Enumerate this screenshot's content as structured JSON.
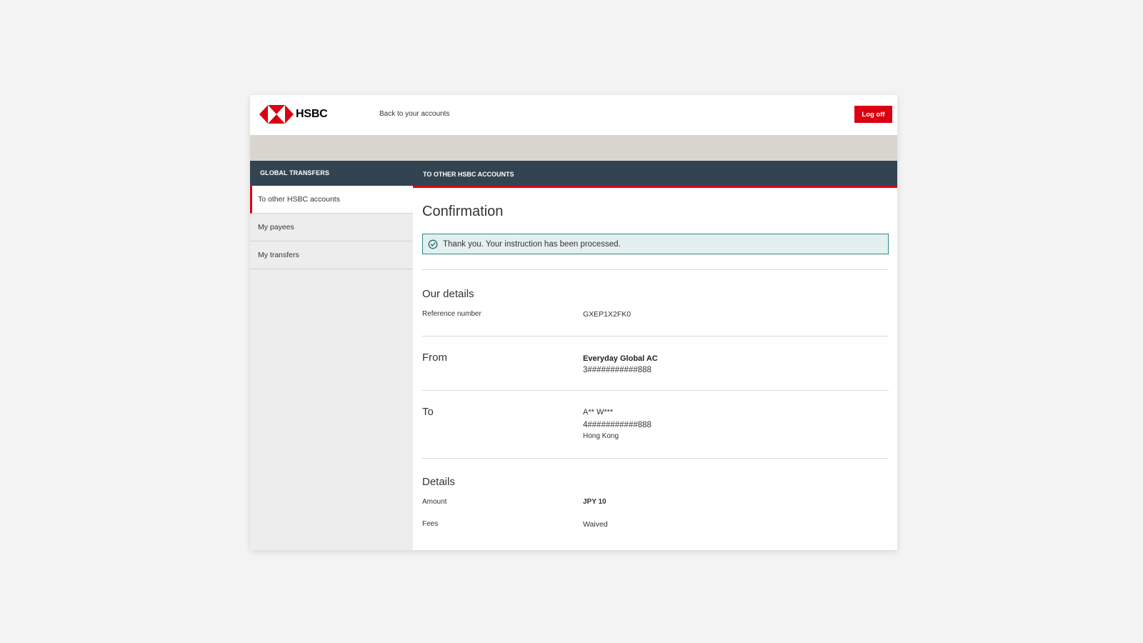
{
  "header": {
    "brand": "HSBC",
    "back_link": "Back to your accounts",
    "logoff_label": "Log off"
  },
  "sidebar": {
    "title": "GLOBAL TRANSFERS",
    "items": [
      {
        "label": "To other HSBC accounts",
        "active": true
      },
      {
        "label": "My payees",
        "active": false
      },
      {
        "label": "My transfers",
        "active": false
      }
    ]
  },
  "main": {
    "section_header": "TO OTHER HSBC ACCOUNTS",
    "page_title": "Confirmation",
    "alert_text": "Thank you. Your instruction has been processed.",
    "our_details": {
      "title": "Our details",
      "reference_label": "Reference number",
      "reference_value": "GXEP1X2FK0"
    },
    "from": {
      "title": "From",
      "account_name": "Everyday Global AC",
      "account_number": "3###########888"
    },
    "to": {
      "title": "To",
      "payee_name": "A** W***",
      "account_number": "4###########888",
      "location": "Hong Kong"
    },
    "details": {
      "title": "Details",
      "amount_label": "Amount",
      "amount_value": "JPY 10",
      "fees_label": "Fees",
      "fees_value": "Waived"
    }
  },
  "colors": {
    "brand_red": "#db0011",
    "nav_dark": "#324452",
    "success_border": "#2a8b86",
    "success_bg": "#e4f0ef"
  }
}
